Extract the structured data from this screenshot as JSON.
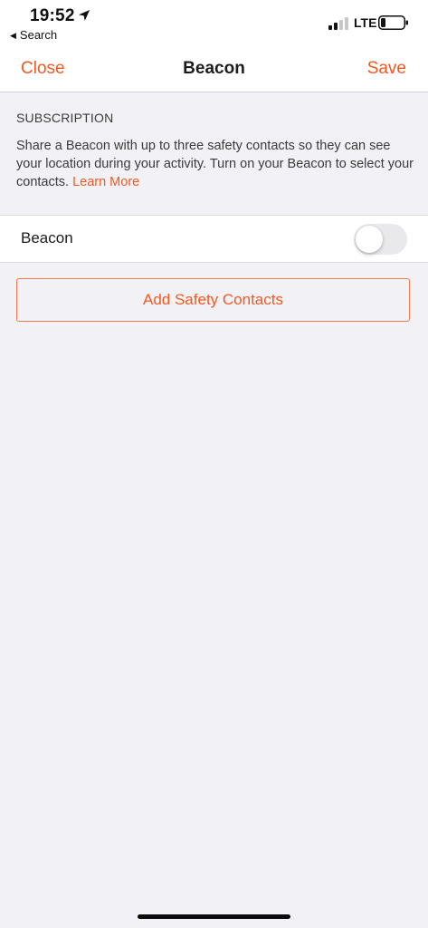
{
  "status_bar": {
    "time": "19:52",
    "back_app": "Search",
    "network": "LTE",
    "location_icon": "location-arrow-icon",
    "signal_icon": "cellular-signal-icon",
    "battery_icon": "battery-icon"
  },
  "nav": {
    "close_label": "Close",
    "title": "Beacon",
    "save_label": "Save"
  },
  "subscription": {
    "header": "SUBSCRIPTION",
    "description": "Share a Beacon with up to three safety contacts so they can see your location during your activity. Turn on your Beacon to select your contacts.",
    "learn_more": "Learn More"
  },
  "beacon_row": {
    "label": "Beacon",
    "enabled": false
  },
  "add_contacts_label": "Add Safety Contacts",
  "colors": {
    "accent": "#f05a22",
    "background": "#f2f2f6",
    "surface": "#ffffff"
  }
}
